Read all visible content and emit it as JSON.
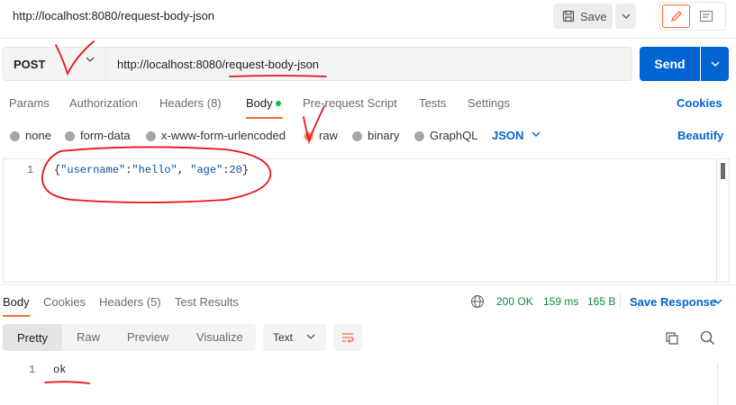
{
  "title": "http://localhost:8080/request-body-json",
  "toolbar": {
    "save_label": "Save"
  },
  "request": {
    "method": "POST",
    "url": "http://localhost:8080/request-body-json",
    "send_label": "Send"
  },
  "req_tabs": {
    "items": [
      "Params",
      "Authorization",
      "Headers (8)",
      "Body",
      "Pre-request Script",
      "Tests",
      "Settings"
    ],
    "active": "Body",
    "cookies": "Cookies"
  },
  "body_types": {
    "options": [
      "none",
      "form-data",
      "x-www-form-urlencoded",
      "raw",
      "binary",
      "GraphQL"
    ],
    "selected": "raw",
    "format": "JSON",
    "beautify": "Beautify"
  },
  "editor": {
    "line_number": "1",
    "open_brace": "{",
    "key1": "\"username\"",
    "colon1": ":",
    "val1": "\"hello\"",
    "comma": ", ",
    "key2": "\"age\"",
    "colon2": ":",
    "val2": "20",
    "close_brace": "}"
  },
  "resp_tabs": {
    "items": [
      "Body",
      "Cookies",
      "Headers (5)",
      "Test Results"
    ],
    "active": "Body"
  },
  "status": {
    "code": "200 OK",
    "time": "159 ms",
    "size": "165 B"
  },
  "save_response": "Save Response",
  "view_modes": {
    "items": [
      "Pretty",
      "Raw",
      "Preview",
      "Visualize"
    ],
    "active": "Pretty"
  },
  "format_select": "Text",
  "response": {
    "line_number": "1",
    "text": "ok"
  },
  "colors": {
    "accent": "#f26b3a",
    "primary": "#0265d2",
    "success": "#0c8a3d",
    "annotation": "#e8141a"
  },
  "icons": [
    "save-icon",
    "chevron-down-icon",
    "pencil-icon",
    "comment-icon",
    "globe-icon",
    "wrap-icon",
    "copy-icon",
    "search-icon"
  ]
}
